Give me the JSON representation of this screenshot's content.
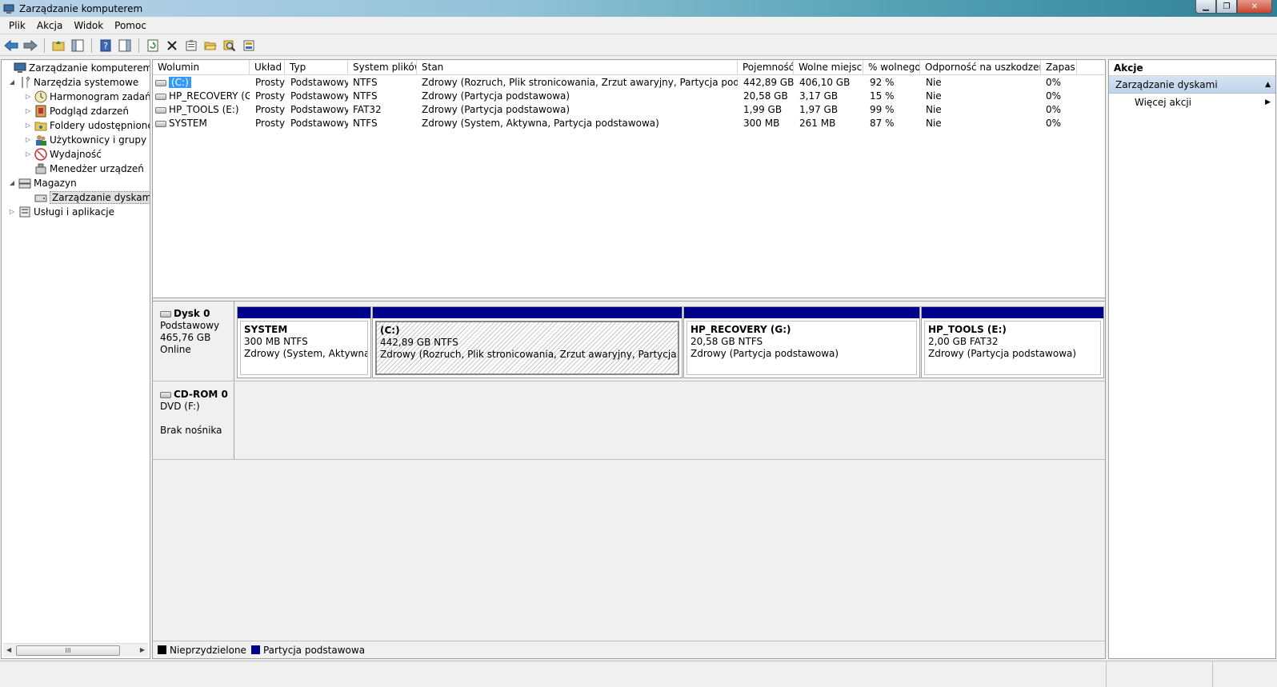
{
  "window": {
    "title": "Zarządzanie komputerem"
  },
  "menu": [
    "Plik",
    "Akcja",
    "Widok",
    "Pomoc"
  ],
  "tree": [
    {
      "label": "Zarządzanie komputerem (loka",
      "indent": 0,
      "toggle": "",
      "icon": "computer-management-icon"
    },
    {
      "label": "Narzędzia systemowe",
      "indent": 1,
      "toggle": "◢",
      "icon": "system-tools-icon"
    },
    {
      "label": "Harmonogram zadań",
      "indent": 2,
      "toggle": "▷",
      "icon": "task-scheduler-icon"
    },
    {
      "label": "Podgląd zdarzeń",
      "indent": 2,
      "toggle": "▷",
      "icon": "event-viewer-icon"
    },
    {
      "label": "Foldery udostępnione",
      "indent": 2,
      "toggle": "▷",
      "icon": "shared-folders-icon"
    },
    {
      "label": "Użytkownicy i grupy lok",
      "indent": 2,
      "toggle": "▷",
      "icon": "users-groups-icon"
    },
    {
      "label": "Wydajność",
      "indent": 2,
      "toggle": "▷",
      "icon": "performance-icon"
    },
    {
      "label": "Menedżer urządzeń",
      "indent": 2,
      "toggle": "",
      "icon": "device-manager-icon"
    },
    {
      "label": "Magazyn",
      "indent": 1,
      "toggle": "◢",
      "icon": "storage-icon"
    },
    {
      "label": "Zarządzanie dyskami",
      "indent": 2,
      "toggle": "",
      "icon": "disk-management-icon",
      "selected": true
    },
    {
      "label": "Usługi i aplikacje",
      "indent": 1,
      "toggle": "▷",
      "icon": "services-apps-icon"
    }
  ],
  "volume_table": {
    "columns": [
      "Wolumin",
      "Układ",
      "Typ",
      "System plików",
      "Stan",
      "Pojemność",
      "Wolne miejsce",
      "% wolnego",
      "Odporność na uszkodzenia",
      "Zapas"
    ],
    "rows": [
      [
        "(C:)",
        "Prosty",
        "Podstawowy",
        "NTFS",
        "Zdrowy (Rozruch, Plik stronicowania, Zrzut awaryjny, Partycja podstawowa)",
        "442,89 GB",
        "406,10 GB",
        "92 %",
        "Nie",
        "0%"
      ],
      [
        "HP_RECOVERY (G:)",
        "Prosty",
        "Podstawowy",
        "NTFS",
        "Zdrowy (Partycja podstawowa)",
        "20,58 GB",
        "3,17 GB",
        "15 %",
        "Nie",
        "0%"
      ],
      [
        "HP_TOOLS (E:)",
        "Prosty",
        "Podstawowy",
        "FAT32",
        "Zdrowy (Partycja podstawowa)",
        "1,99 GB",
        "1,97 GB",
        "99 %",
        "Nie",
        "0%"
      ],
      [
        "SYSTEM",
        "Prosty",
        "Podstawowy",
        "NTFS",
        "Zdrowy (System, Aktywna, Partycja podstawowa)",
        "300 MB",
        "261 MB",
        "87 %",
        "Nie",
        "0%"
      ]
    ]
  },
  "disks": {
    "disk0": {
      "name": "Dysk 0",
      "type": "Podstawowy",
      "size": "465,76 GB",
      "status": "Online",
      "partitions": [
        {
          "name": "SYSTEM",
          "size": "300 MB NTFS",
          "status": "Zdrowy (System, Aktywna, Pa"
        },
        {
          "name": "(C:)",
          "size": "442,89 GB NTFS",
          "status": "Zdrowy (Rozruch, Plik stronicowania, Zrzut awaryjny, Partycja podstawo"
        },
        {
          "name": "HP_RECOVERY  (G:)",
          "size": "20,58 GB NTFS",
          "status": "Zdrowy (Partycja podstawowa)"
        },
        {
          "name": "HP_TOOLS  (E:)",
          "size": "2,00 GB FAT32",
          "status": "Zdrowy (Partycja podstawowa)"
        }
      ]
    },
    "cdrom0": {
      "name": "CD-ROM 0",
      "type": "DVD (F:)",
      "status": "Brak nośnika"
    }
  },
  "legend": {
    "unallocated": "Nieprzydzielone",
    "primary": "Partycja podstawowa",
    "unallocated_color": "#000000",
    "primary_color": "#00008b"
  },
  "actions": {
    "title": "Akcje",
    "section": "Zarządzanie dyskami",
    "more": "Więcej akcji"
  },
  "scrollbar": {
    "thumb_glyph": "III"
  }
}
